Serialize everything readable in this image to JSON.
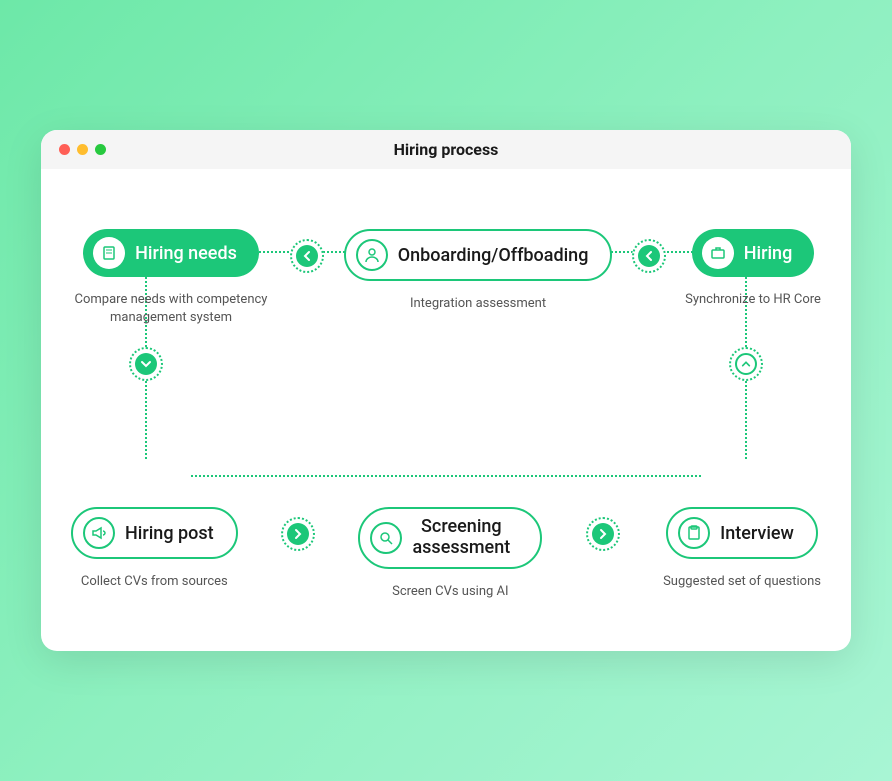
{
  "window": {
    "title": "Hiring process"
  },
  "nodes": {
    "n1": {
      "label": "Hiring needs",
      "sub": "Compare needs with competency management system"
    },
    "n2": {
      "label": "Onboarding/Offboading",
      "sub": "Integration assessment"
    },
    "n3": {
      "label": "Hiring",
      "sub": "Synchronize to HR Core"
    },
    "n4": {
      "label": "Hiring post",
      "sub": "Collect CVs from sources"
    },
    "n5": {
      "label": "Screening assessment",
      "sub": "Screen CVs using AI"
    },
    "n6": {
      "label": "Interview",
      "sub": "Suggested set of questions"
    }
  },
  "colors": {
    "accent": "#1cc779"
  }
}
